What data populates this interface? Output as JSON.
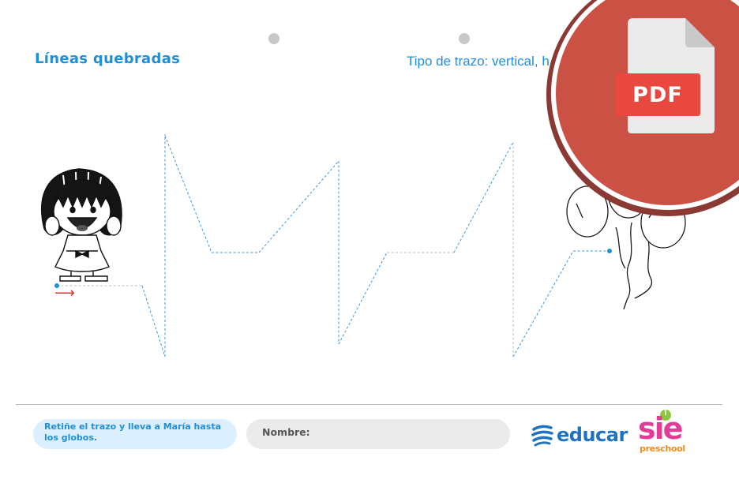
{
  "worksheet": {
    "title": "Líneas quebradas",
    "subtitle": "Tipo de trazo: vertical, h"
  },
  "footer": {
    "instruction": "Retiñe el trazo y lleva a María hasta los globos.",
    "name_label": "Nombre:",
    "brand_educar": "educar",
    "brand_sie": "sie",
    "brand_sie_sub": "preschool"
  },
  "overlay": {
    "pdf_label": "PDF"
  },
  "colors": {
    "accent": "#1f8fd6",
    "trace": "#3a97d8",
    "pdf_red": "#cc5145",
    "sie_pink": "#e23d96",
    "sie_orange": "#f28d1a"
  },
  "icons": [
    "girl-illustration",
    "balloons-illustration",
    "start-arrow-icon",
    "pdf-file-icon",
    "educar-logo",
    "sie-preschool-logo"
  ]
}
